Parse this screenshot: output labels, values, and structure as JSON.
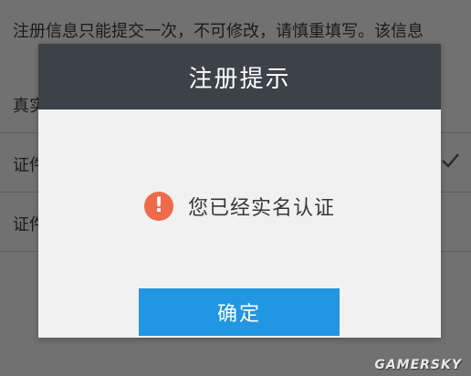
{
  "background_form": {
    "notice_text": "注册信息只能提交一次，不可修改，请慎重填写。该信息",
    "rows": [
      {
        "label": "真实"
      },
      {
        "label": "证件"
      },
      {
        "label": "证件"
      }
    ],
    "check_icon": "checkmark-icon"
  },
  "dialog": {
    "title": "注册提示",
    "message": "您已经实名认证",
    "message_icon": "exclamation-circle-icon",
    "icon_color": "#ef6a4a",
    "confirm_label": "确定",
    "confirm_color": "#2196e3",
    "header_color": "#3d4248"
  },
  "watermark": "GAMERSKY"
}
